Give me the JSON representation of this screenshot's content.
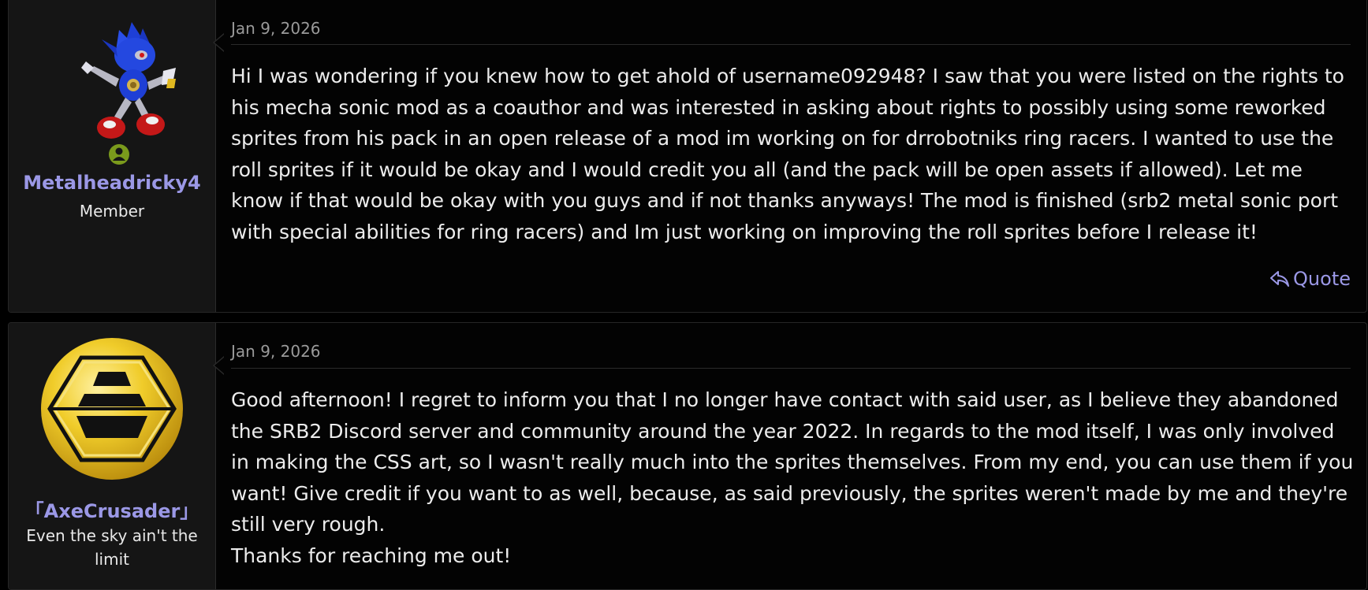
{
  "posts": [
    {
      "username": "Metalheadricky4",
      "user_title": "Member",
      "avatar_icon": "metal-sonic-sprite-icon",
      "online_icon": "online-status-icon",
      "date": "Jan 9, 2026",
      "message": "Hi I was wondering if you knew how to get ahold of username092948? I saw that you were listed on the rights to his mecha sonic mod as a coauthor and was interested in asking about rights to possibly using some reworked sprites from his pack in an open release of a mod im working on for drrobotniks ring racers. I wanted to use the roll sprites if it would be okay and I would credit you all (and the pack will be open assets if allowed). Let me know if that would be okay with you guys and if not thanks anyways! The mod is finished (srb2 metal sonic port with special abilities for ring racers) and Im just working on improving the roll sprites before I release it!",
      "quote_label": "Quote"
    },
    {
      "username": "「AxeCrusader」",
      "user_title": "Even the sky ain't the limit",
      "avatar_icon": "gold-hexagon-emblem-icon",
      "date": "Jan 9, 2026",
      "message_lines": [
        "Good afternoon! I regret to inform you that I no longer have contact with said user, as I believe they abandoned the SRB2 Discord server and community around the year 2022. In regards to the mod itself, I was only involved in making the CSS art, so I wasn't really much into the sprites themselves. From my end, you can use them if you want! Give credit if you want to as well, because, as said previously, the sprites weren't made by me and they're still very rough.",
        "Thanks for reaching me out!"
      ]
    }
  ],
  "colors": {
    "accent": "#9b98e6",
    "sidebar_bg": "#151515",
    "online": "#7a9a1c",
    "gold": "#e9c21e"
  }
}
